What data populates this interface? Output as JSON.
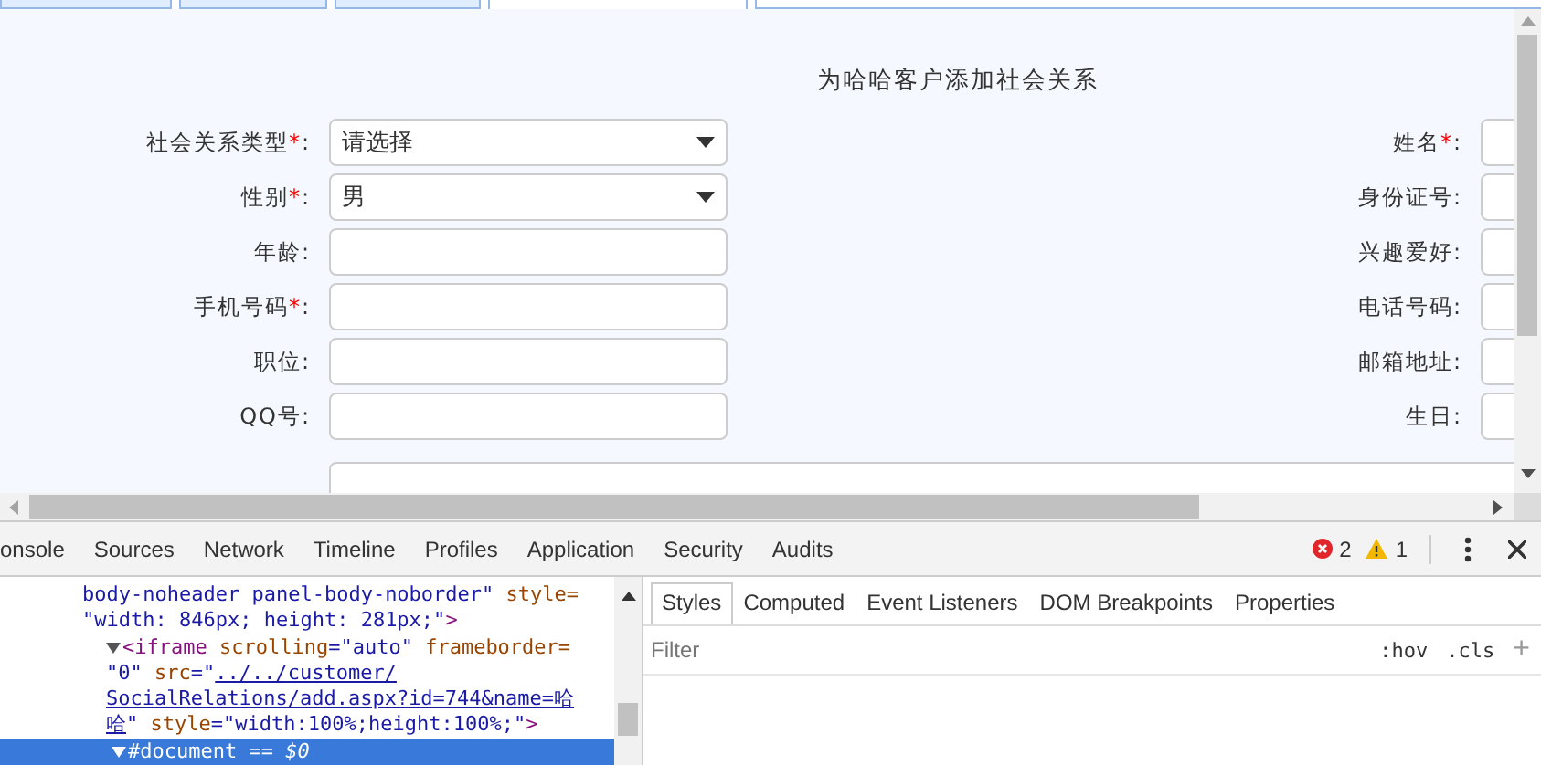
{
  "top_tabs": [
    {
      "selected": false
    },
    {
      "selected": false
    },
    {
      "selected": false
    },
    {
      "selected": true
    }
  ],
  "form": {
    "title": "为哈哈客户添加社会关系",
    "required_mark": "*",
    "label_suffix": ":",
    "left_fields": [
      {
        "label": "社会关系类型",
        "required": true,
        "kind": "select",
        "value": "请选择"
      },
      {
        "label": "性别",
        "required": true,
        "kind": "select",
        "value": "男"
      },
      {
        "label": "年龄",
        "required": false,
        "kind": "input"
      },
      {
        "label": "手机号码",
        "required": true,
        "kind": "input"
      },
      {
        "label": "职位",
        "required": false,
        "kind": "input"
      },
      {
        "label": "QQ号",
        "required": false,
        "kind": "input"
      }
    ],
    "right_fields": [
      {
        "label": "姓名",
        "required": true,
        "kind": "input"
      },
      {
        "label": "身份证号",
        "required": false,
        "kind": "input"
      },
      {
        "label": "兴趣爱好",
        "required": false,
        "kind": "input"
      },
      {
        "label": "电话号码",
        "required": false,
        "kind": "input"
      },
      {
        "label": "邮箱地址",
        "required": false,
        "kind": "input"
      },
      {
        "label": "生日",
        "required": false,
        "kind": "input"
      }
    ]
  },
  "devtools": {
    "tabs": [
      "onsole",
      "Sources",
      "Network",
      "Timeline",
      "Profiles",
      "Application",
      "Security",
      "Audits"
    ],
    "errors": "2",
    "warnings": "1",
    "elements_tree": [
      {
        "lines": [
          [
            {
              "kind": "value",
              "text": "body-noheader panel-body-noborder\""
            },
            {
              "kind": "attr",
              "text": " style="
            }
          ],
          [
            {
              "kind": "value",
              "text": "\"width: 846px; height: 281px;\""
            },
            {
              "kind": "tag",
              "text": ">"
            }
          ]
        ],
        "children": [
          {
            "expanded": true,
            "lines": [
              [
                {
                  "kind": "tag",
                  "text": "<iframe"
                },
                {
                  "kind": "attr",
                  "text": " scrolling"
                },
                {
                  "kind": "value",
                  "text": "=\"auto\""
                },
                {
                  "kind": "attr",
                  "text": " frameborder="
                }
              ],
              [
                {
                  "kind": "value",
                  "text": "\"0\""
                },
                {
                  "kind": "attr",
                  "text": " src"
                },
                {
                  "kind": "value",
                  "text": "=\""
                },
                {
                  "kind": "link",
                  "text": "../../customer/"
                }
              ],
              [
                {
                  "kind": "link",
                  "text": "SocialRelations/add.aspx?id=744&name=哈"
                }
              ],
              [
                {
                  "kind": "link",
                  "text": "哈"
                },
                {
                  "kind": "value",
                  "text": "\""
                },
                {
                  "kind": "attr",
                  "text": " style"
                },
                {
                  "kind": "value",
                  "text": "=\"width:100%;height:100%;\""
                },
                {
                  "kind": "tag",
                  "text": ">"
                }
              ]
            ],
            "children": [
              {
                "expanded": true,
                "selected": true,
                "lines": [
                  [
                    {
                      "kind": "node",
                      "text": "#document"
                    },
                    {
                      "kind": "muted",
                      "text": " == $0"
                    }
                  ]
                ]
              }
            ]
          }
        ]
      }
    ],
    "styles_tabs": [
      {
        "label": "Styles",
        "selected": true
      },
      {
        "label": "Computed",
        "selected": false
      },
      {
        "label": "Event Listeners",
        "selected": false
      },
      {
        "label": "DOM Breakpoints",
        "selected": false
      },
      {
        "label": "Properties",
        "selected": false
      }
    ],
    "filter": {
      "placeholder": "Filter"
    },
    "hov": ":hov",
    "cls": ".cls",
    "add": "+"
  }
}
